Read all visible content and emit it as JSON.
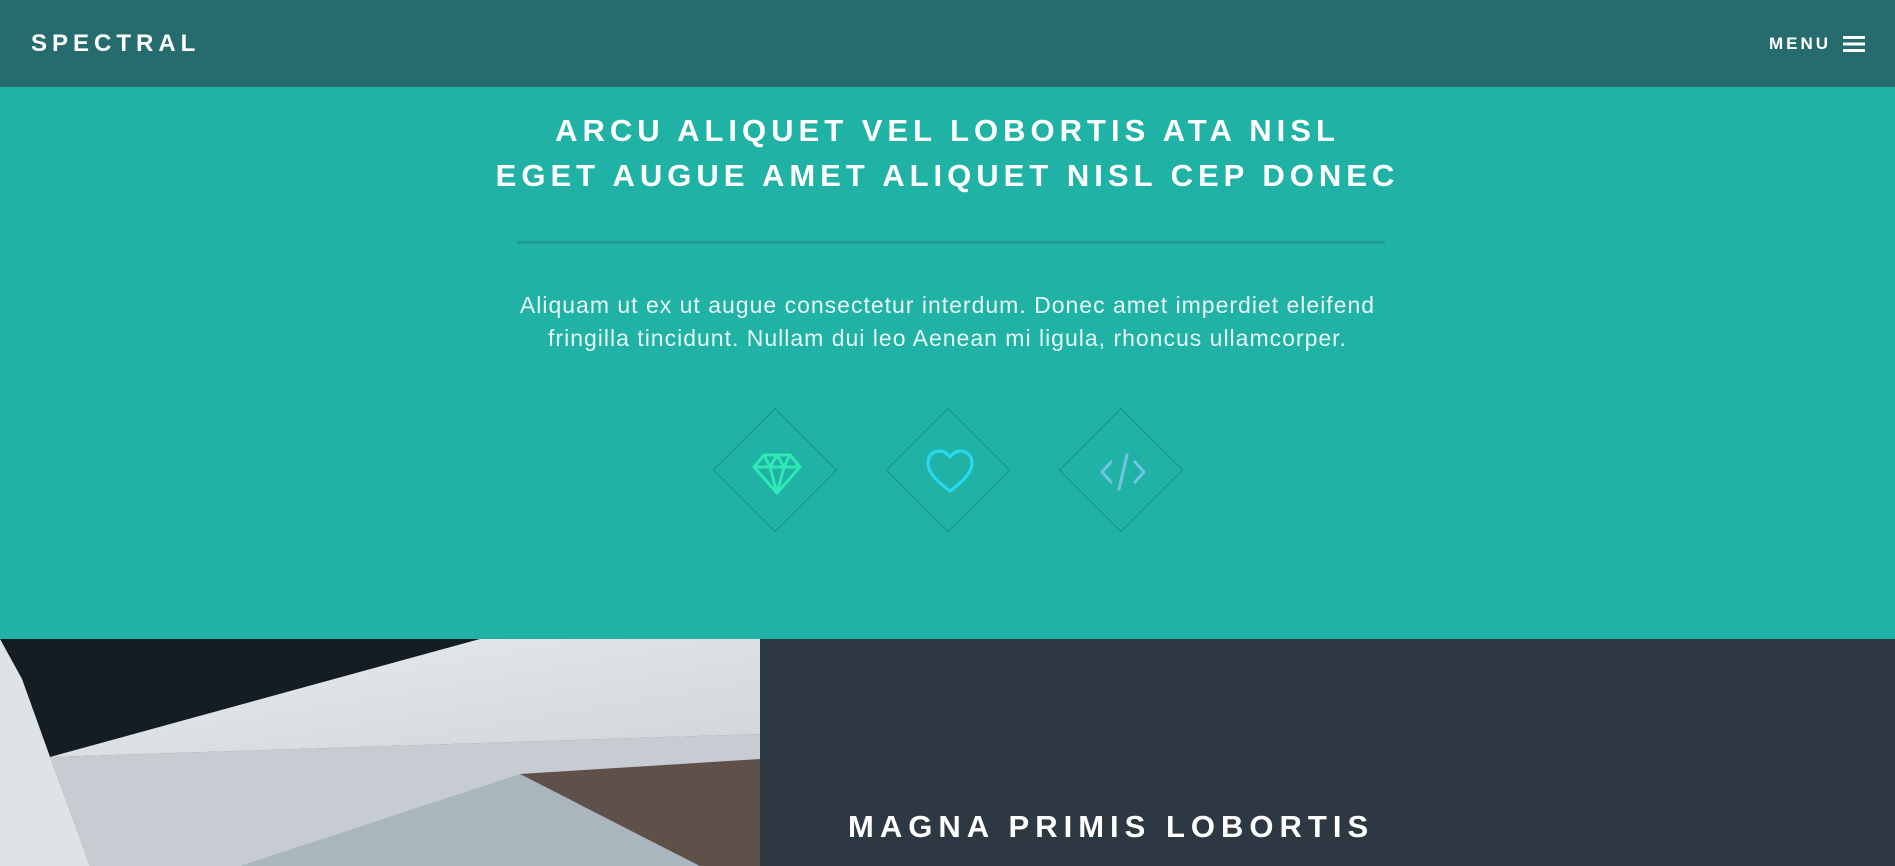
{
  "header": {
    "logo": "SPECTRAL",
    "menu_label": "MENU",
    "menu_icon": "hamburger-icon"
  },
  "banner": {
    "headline_line1": "ARCU ALIQUET VEL LOBORTIS ATA NISL",
    "headline_line2": "EGET AUGUE AMET ALIQUET NISL CEP DONEC",
    "lead_line1": "Aliquam ut ex ut augue consectetur interdum. Donec amet imperdiet eleifend",
    "lead_line2": "fringilla tincidunt. Nullam dui leo Aenean mi ligula, rhoncus ullamcorper.",
    "icons": [
      {
        "name": "diamond-gem-icon",
        "color": "#2ee8b6"
      },
      {
        "name": "heart-icon",
        "color": "#29d9f0"
      },
      {
        "name": "code-icon",
        "color": "#6fc4e8"
      }
    ]
  },
  "features": {
    "title": "MAGNA PRIMIS LOBORTIS"
  },
  "colors": {
    "accent": "#21b2a6",
    "header_bg": "#266c6e",
    "dark": "#2e3842"
  }
}
